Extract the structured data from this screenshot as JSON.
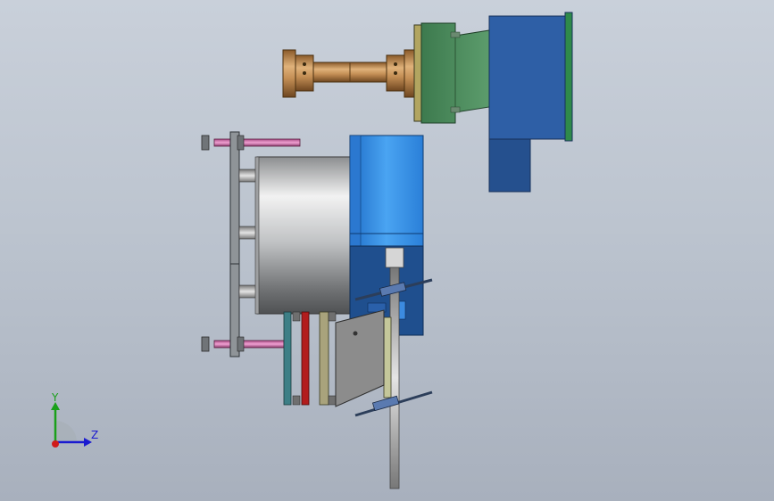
{
  "viewport": {
    "background_top": "#c9d0da",
    "background_bottom": "#a8b0bd"
  },
  "triad": {
    "y_label": "Y",
    "z_label": "Z",
    "y_color": "#1aa01a",
    "z_color": "#1a1ad0",
    "x_color": "#d01a1a"
  },
  "colors": {
    "bronze": "#b8864b",
    "green_housing": "#4a8a5c",
    "blue_motor": "#2d5fa8",
    "bright_blue": "#2e86e0",
    "chrome": "#a9abad",
    "pink_rod": "#cc6fa8",
    "red_plate": "#b01c1c",
    "teal_plate": "#3a8a8a",
    "olive_plate": "#a8a878",
    "gray_bracket": "#8e8e8e"
  }
}
